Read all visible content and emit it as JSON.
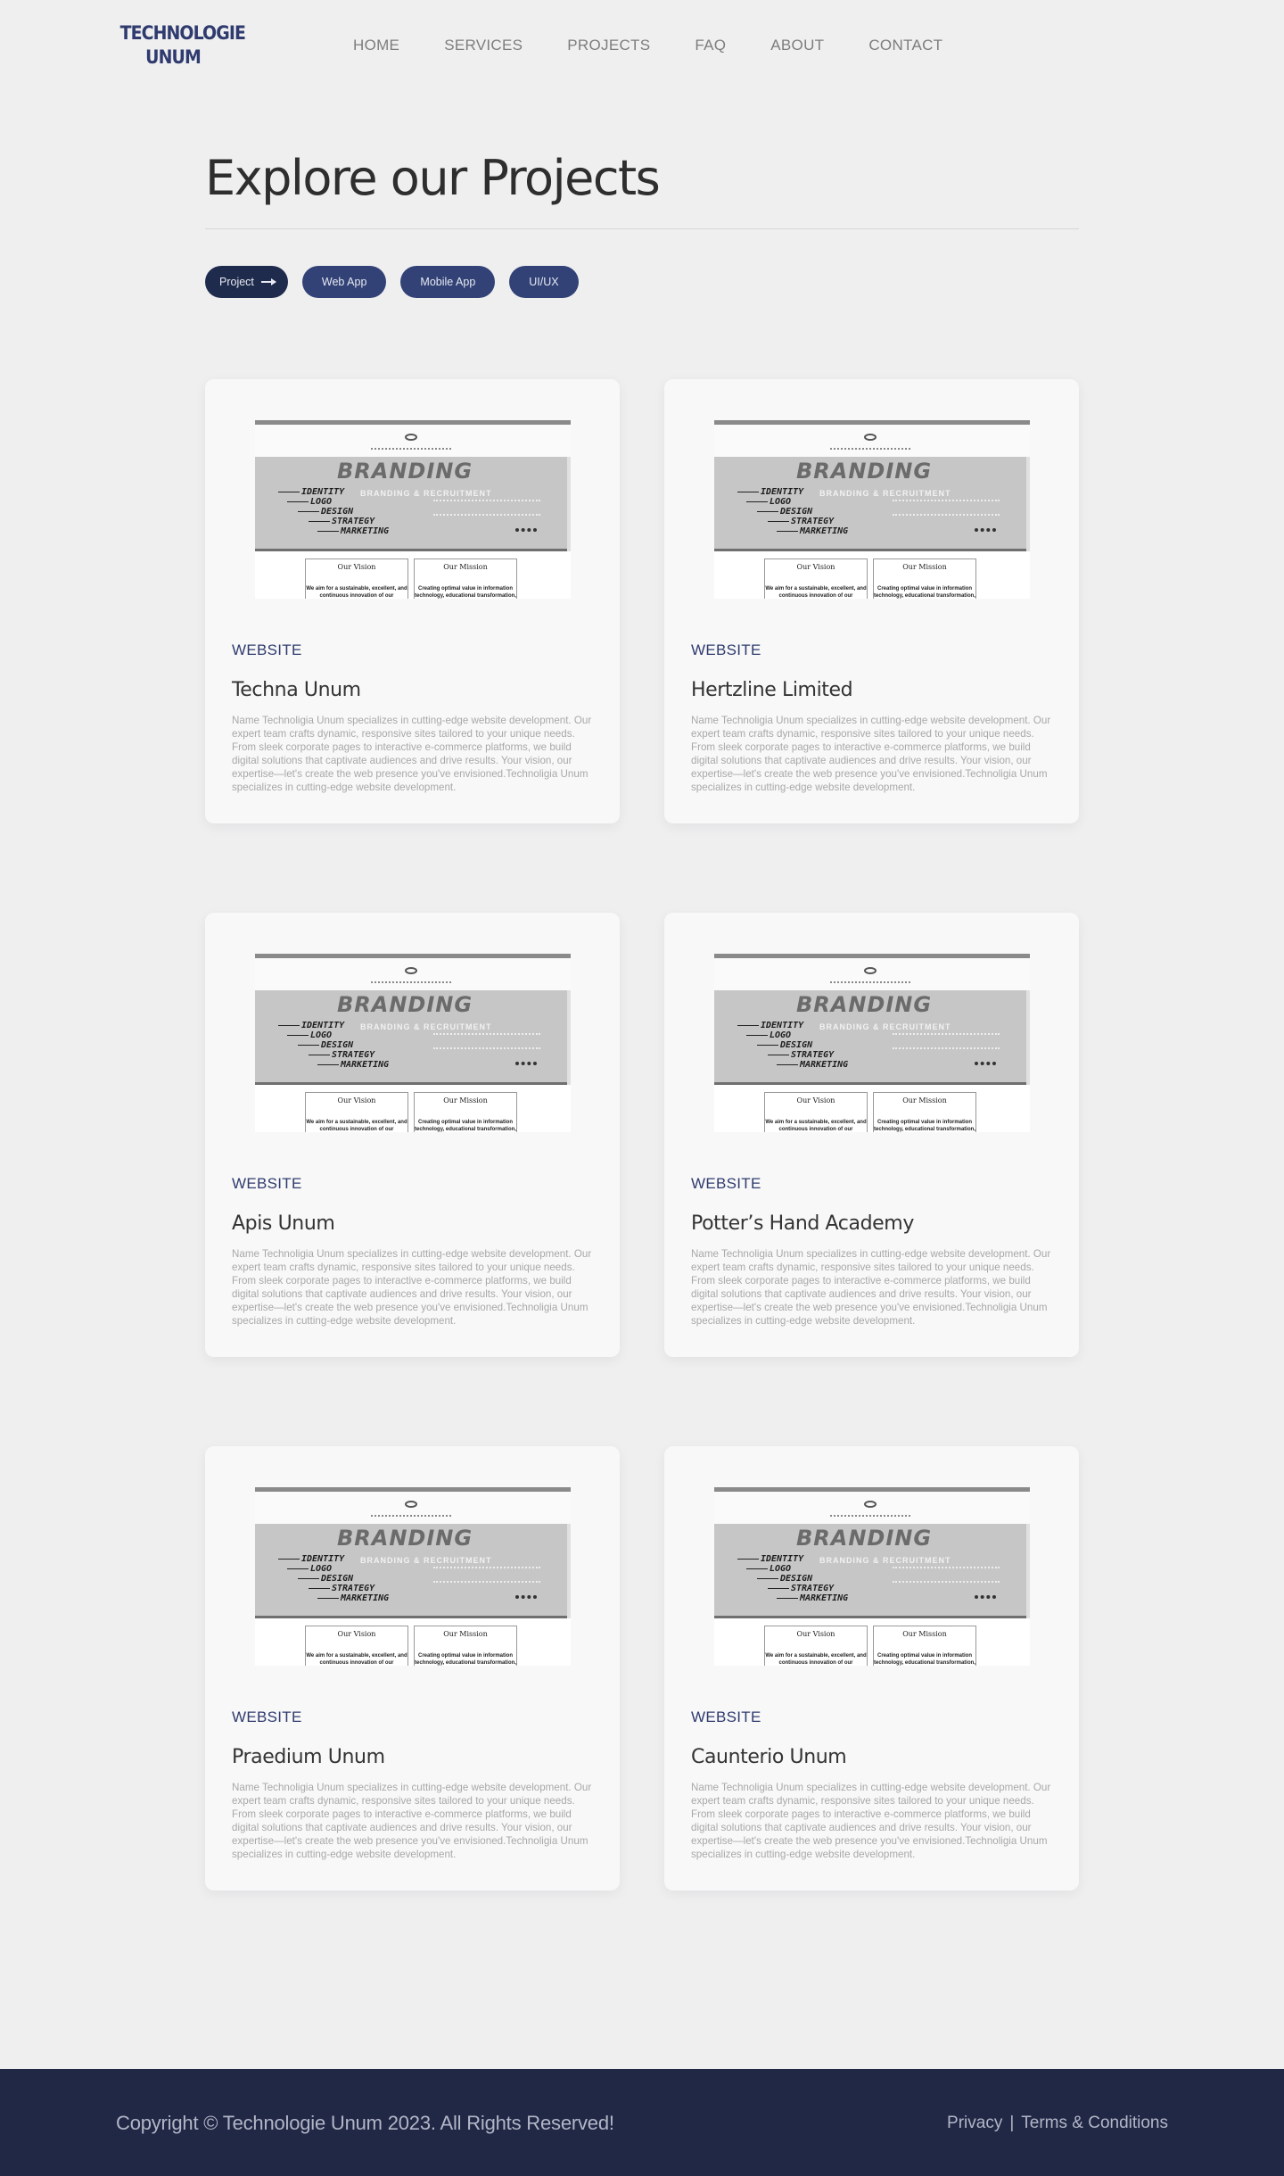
{
  "brand": {
    "line1": "TECHNOLOGIE",
    "line2": "UNUM"
  },
  "nav": [
    {
      "label": "HOME"
    },
    {
      "label": "SERVICES"
    },
    {
      "label": "PROJECTS"
    },
    {
      "label": "FAQ"
    },
    {
      "label": "ABOUT"
    },
    {
      "label": "CONTACT"
    }
  ],
  "page": {
    "title": "Explore our Projects"
  },
  "filters": [
    {
      "label": "Project",
      "active": true
    },
    {
      "label": "Web App"
    },
    {
      "label": "Mobile App"
    },
    {
      "label": "UI/UX"
    }
  ],
  "thumbnail": {
    "headline": "BRANDING",
    "subheadline": "BRANDING & RECRUITMENT",
    "list": [
      "IDENTITY",
      "LOGO",
      "DESIGN",
      "STRATEGY",
      "MARKETING"
    ],
    "vision_title": "Our Vision",
    "vision_text": "We aim for a sustainable, excellent, and continuous innovation of our",
    "mission_title": "Our Mission",
    "mission_text": "Creating optimal value in information technology, educational transformation,"
  },
  "projects": [
    {
      "category": "WEBSITE",
      "title": "Techna Unum",
      "description": "Name Technoligia Unum specializes in cutting-edge website development. Our expert team crafts dynamic, responsive sites tailored to your unique needs. From sleek corporate pages to interactive e-commerce platforms, we build digital solutions that captivate audiences and drive results. Your vision, our expertise—let's create the web presence you've envisioned.Technoligia Unum specializes in cutting-edge website development."
    },
    {
      "category": "WEBSITE",
      "title": "Hertzline Limited",
      "description": "Name Technoligia Unum specializes in cutting-edge website development. Our expert team crafts dynamic, responsive sites tailored to your unique needs. From sleek corporate pages to interactive e-commerce platforms, we build digital solutions that captivate audiences and drive results. Your vision, our expertise—let's create the web presence you've envisioned.Technoligia Unum specializes in cutting-edge website development."
    },
    {
      "category": "WEBSITE",
      "title": "Apis Unum",
      "description": "Name Technoligia Unum specializes in cutting-edge website development. Our expert team crafts dynamic, responsive sites tailored to your unique needs. From sleek corporate pages to interactive e-commerce platforms, we build digital solutions that captivate audiences and drive results. Your vision, our expertise—let's create the web presence you've envisioned.Technoligia Unum specializes in cutting-edge website development."
    },
    {
      "category": "WEBSITE",
      "title": "Potter’s Hand Academy",
      "description": "Name Technoligia Unum specializes in cutting-edge website development. Our expert team crafts dynamic, responsive sites tailored to your unique needs. From sleek corporate pages to interactive e-commerce platforms, we build digital solutions that captivate audiences and drive results. Your vision, our expertise—let's create the web presence you've envisioned.Technoligia Unum specializes in cutting-edge website development."
    },
    {
      "category": "WEBSITE",
      "title": "Praedium Unum",
      "description": "Name Technoligia Unum specializes in cutting-edge website development. Our expert team crafts dynamic, responsive sites tailored to your unique needs. From sleek corporate pages to interactive e-commerce platforms, we build digital solutions that captivate audiences and drive results. Your vision, our expertise—let's create the web presence you've envisioned.Technoligia Unum specializes in cutting-edge website development."
    },
    {
      "category": "WEBSITE",
      "title": "Caunterio Unum",
      "description": "Name Technoligia Unum specializes in cutting-edge website development. Our expert team crafts dynamic, responsive sites tailored to your unique needs. From sleek corporate pages to interactive e-commerce platforms, we build digital solutions that captivate audiences and drive results. Your vision, our expertise—let's create the web presence you've envisioned.Technoligia Unum specializes in cutting-edge website development."
    }
  ],
  "footer": {
    "copyright": "Copyright © Technologie Unum 2023. All Rights Reserved!",
    "privacy": "Privacy",
    "separator": "|",
    "terms": "Terms & Conditions"
  },
  "colors": {
    "brand_navy": "#2f3b6e",
    "pill": "#324276",
    "pill_active": "#1f2b4c",
    "footer": "#212846",
    "background": "#efeff0"
  }
}
